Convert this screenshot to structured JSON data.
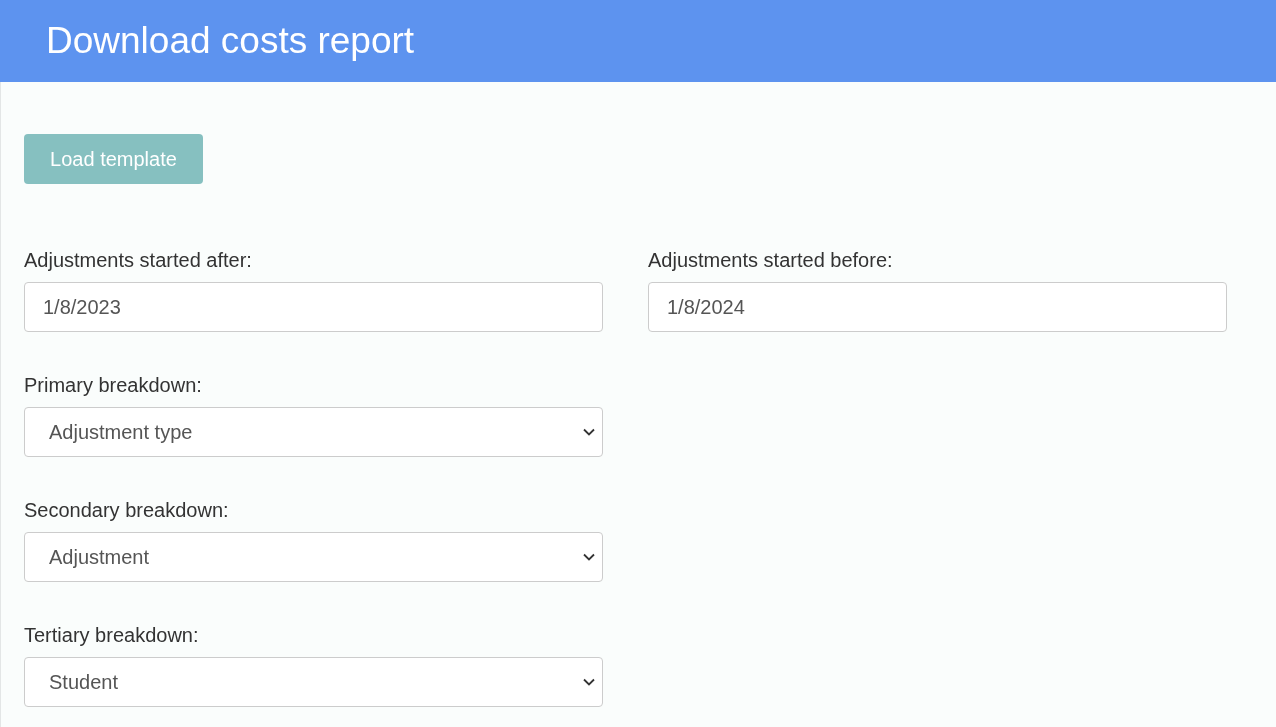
{
  "header": {
    "title": "Download costs report"
  },
  "load_button": {
    "label": "Load template"
  },
  "date_fields": [
    {
      "label": "Adjustments started after:",
      "value": "1/8/2023"
    },
    {
      "label": "Adjustments started before:",
      "value": "1/8/2024"
    }
  ],
  "breakdowns": [
    {
      "label": "Primary breakdown:",
      "value": "Adjustment type"
    },
    {
      "label": "Secondary breakdown:",
      "value": "Adjustment"
    },
    {
      "label": "Tertiary breakdown:",
      "value": "Student"
    }
  ]
}
